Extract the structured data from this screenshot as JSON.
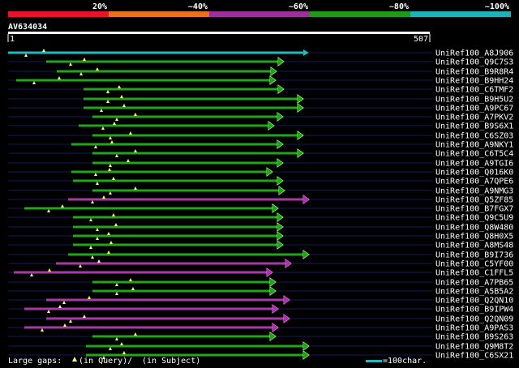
{
  "title": "AV634034",
  "query_length": 507,
  "ruler": {
    "start_label": "1",
    "end_label": "507"
  },
  "identity_scale": [
    {
      "label": "20%",
      "color": "#e8122d"
    },
    {
      "label": "~40%",
      "color": "#e8721d"
    },
    {
      "label": "~60%",
      "color": "#9d2f9d"
    },
    {
      "label": "~80%",
      "color": "#1f9b18"
    },
    {
      "label": "~100%",
      "color": "#1fb3b8"
    }
  ],
  "footer": {
    "gaps_prefix": "Large gaps:",
    "query_gap_text": "(in Query)/",
    "subject_gap_text": "(in Subject)",
    "scale_text": "=100char."
  },
  "colors": {
    "green": "#22a51b",
    "green_head": "#7cff5c",
    "purple": "#a83aa8",
    "purple_head": "#ff5cff",
    "cyan": "#21b9be",
    "navy": "#141c5c"
  },
  "hits": [
    {
      "id": "UniRef100_A8J906",
      "tier": "cyan",
      "s": 10,
      "e": 381,
      "sl": 0,
      "sr": 0
    },
    {
      "id": "UniRef100_Q9C7S3",
      "tier": "green",
      "s": 57,
      "e": 350,
      "sl": 45,
      "sr": 2
    },
    {
      "id": "UniRef100_B9R8R4",
      "tier": "green",
      "s": 70,
      "e": 341,
      "sl": 12,
      "sr": 0
    },
    {
      "id": "UniRef100_B9HH24",
      "tier": "green",
      "s": 20,
      "e": 340,
      "sl": 8,
      "sr": 0
    },
    {
      "id": "UniRef100_C6TMF2",
      "tier": "green",
      "s": 103,
      "e": 350,
      "sl": 60,
      "sr": 0
    },
    {
      "id": "UniRef100_B9H5U2",
      "tier": "green",
      "s": 103,
      "e": 374,
      "sl": 60,
      "sr": 0
    },
    {
      "id": "UniRef100_A9PC67",
      "tier": "green",
      "s": 103,
      "e": 374,
      "sl": 60,
      "sr": 0
    },
    {
      "id": "UniRef100_A7PKV2",
      "tier": "green",
      "s": 114,
      "e": 349,
      "sl": 50,
      "sr": 0
    },
    {
      "id": "UniRef100_B9S6X1",
      "tier": "green",
      "s": 97,
      "e": 338,
      "sl": 30,
      "sr": 0
    },
    {
      "id": "UniRef100_C6SZ03",
      "tier": "green",
      "s": 114,
      "e": 374,
      "sl": 50,
      "sr": 0
    },
    {
      "id": "UniRef100_A9NKY1",
      "tier": "green",
      "s": 88,
      "e": 349,
      "sl": 40,
      "sr": 0
    },
    {
      "id": "UniRef100_C6T5C4",
      "tier": "green",
      "s": 114,
      "e": 374,
      "sl": 50,
      "sr": 0
    },
    {
      "id": "UniRef100_A9TGI6",
      "tier": "green",
      "s": 114,
      "e": 349,
      "sl": 50,
      "sr": 0
    },
    {
      "id": "UniRef100_Q016K0",
      "tier": "green",
      "s": 88,
      "e": 336,
      "sl": 40,
      "sr": 0
    },
    {
      "id": "UniRef100_A7QPE6",
      "tier": "green",
      "s": 90,
      "e": 349,
      "sl": 40,
      "sr": 0
    },
    {
      "id": "UniRef100_A9NMG3",
      "tier": "green",
      "s": 114,
      "e": 351,
      "sl": 50,
      "sr": 0
    },
    {
      "id": "UniRef100_Q5ZF85",
      "tier": "purple",
      "s": 84,
      "e": 381,
      "sl": 40,
      "sr": 0
    },
    {
      "id": "UniRef100_B7FGX7",
      "tier": "green",
      "s": 30,
      "e": 343,
      "sl": 8,
      "sr": 0
    },
    {
      "id": "UniRef100_Q9C5U9",
      "tier": "green",
      "s": 90,
      "e": 349,
      "sl": 40,
      "sr": 0
    },
    {
      "id": "UniRef100_Q8W480",
      "tier": "green",
      "s": 90,
      "e": 349,
      "sl": 40,
      "sr": 0
    },
    {
      "id": "UniRef100_Q8H0X5",
      "tier": "green",
      "s": 90,
      "e": 349,
      "sl": 40,
      "sr": 0
    },
    {
      "id": "UniRef100_A8MS48",
      "tier": "green",
      "s": 90,
      "e": 349,
      "sl": 40,
      "sr": 0
    },
    {
      "id": "UniRef100_B9I736",
      "tier": "green",
      "s": 84,
      "e": 381,
      "sl": 30,
      "sr": 0
    },
    {
      "id": "UniRef100_C5YF00",
      "tier": "purple",
      "s": 69,
      "e": 359,
      "sl": 40,
      "sr": 0
    },
    {
      "id": "UniRef100_C1FFL5",
      "tier": "purple",
      "s": 17,
      "e": 336,
      "sl": 8,
      "sr": 0
    },
    {
      "id": "UniRef100_A7PB65",
      "tier": "green",
      "s": 114,
      "e": 340,
      "sl": 50,
      "sr": 0
    },
    {
      "id": "UniRef100_A5B5A2",
      "tier": "green",
      "s": 114,
      "e": 340,
      "sl": 50,
      "sr": 0
    },
    {
      "id": "UniRef100_Q2QN10",
      "tier": "purple",
      "s": 57,
      "e": 357,
      "sl": 45,
      "sr": 0
    },
    {
      "id": "UniRef100_B9IPW4",
      "tier": "purple",
      "s": 30,
      "e": 343,
      "sl": 8,
      "sr": 0
    },
    {
      "id": "UniRef100_Q2QN09",
      "tier": "purple",
      "s": 57,
      "e": 357,
      "sl": 45,
      "sr": 0
    },
    {
      "id": "UniRef100_A9PAS3",
      "tier": "purple",
      "s": 30,
      "e": 343,
      "sl": 8,
      "sr": 0
    },
    {
      "id": "UniRef100_B9S263",
      "tier": "green",
      "s": 114,
      "e": 340,
      "sl": 50,
      "sr": 0
    },
    {
      "id": "UniRef100_Q9M8T2",
      "tier": "green",
      "s": 106,
      "e": 381,
      "sl": 50,
      "sr": 0
    },
    {
      "id": "UniRef100_C6SX21",
      "tier": "green",
      "s": 106,
      "e": 381,
      "sl": 50,
      "sr": 0
    }
  ]
}
